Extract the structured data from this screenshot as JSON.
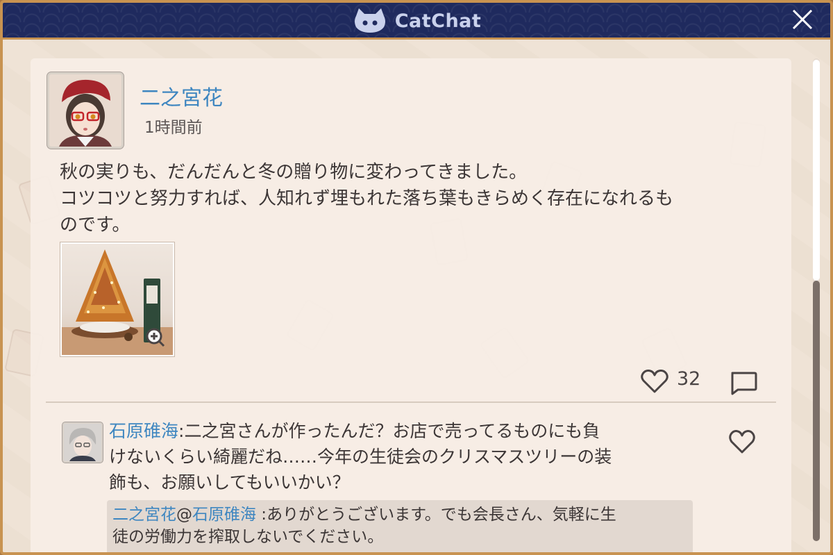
{
  "app": {
    "title": "CatChat"
  },
  "post": {
    "author": "二之宮花",
    "time": "1時間前",
    "body": [
      "秋の実りも、だんだんと冬の贈り物に変わってきました。",
      "コツコツと努力すれば、人知れず埋もれた落ち葉もきらめく存在になれるも",
      "のです。"
    ],
    "likes": "32",
    "colors": {
      "name": "#3e86c0",
      "title_bar": "#1f2a5e",
      "frame": "#c89351"
    }
  },
  "comment": {
    "author": "石原碓海",
    "separator": ":",
    "text_lines": [
      "二之宮さんが作ったんだ？お店で売ってるものにも負",
      "けないくらい綺麗だね……今年の生徒会のクリスマスツリーの装",
      "飾も、お願いしてもいいかい？"
    ]
  },
  "reply": {
    "from": "二之宮花",
    "at": "@",
    "to": "石原碓海",
    "separator": " :",
    "text_lines": [
      "ありがとうございます。でも会長さん、気軽に生",
      "徒の労働力を搾取しないでください。"
    ]
  },
  "icons": {
    "logo": "cat-face-icon",
    "close": "close-icon",
    "like": "heart-icon",
    "comment": "speech-bubble-icon",
    "zoom": "zoom-in-icon"
  }
}
